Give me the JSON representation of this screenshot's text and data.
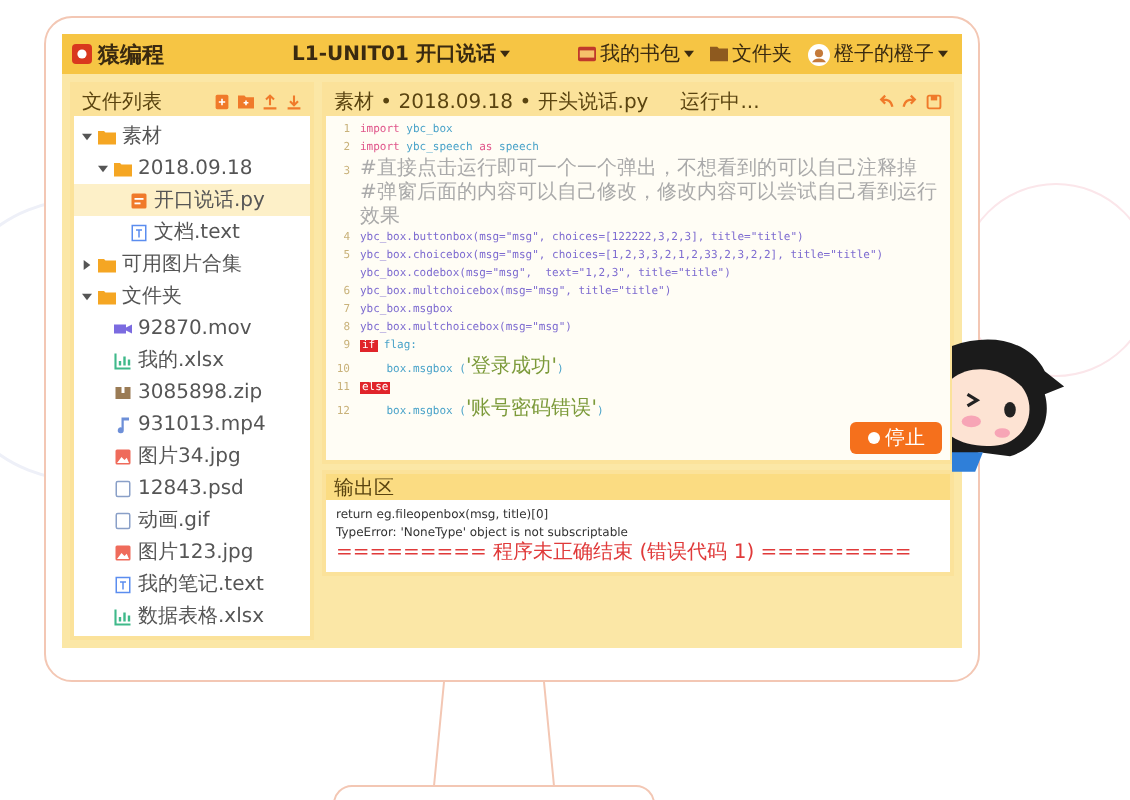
{
  "app": {
    "logo": "猿编程",
    "lesson": {
      "label": "L1-UNIT01 开口说话",
      "dropdown": true
    },
    "menu": [
      {
        "label": "我的书包",
        "kind": "bag",
        "dropdown": true
      },
      {
        "label": "文件夹",
        "kind": "folder",
        "dropdown": false
      }
    ],
    "user": {
      "name": "橙子的橙子",
      "dropdown": true
    }
  },
  "file_panel": {
    "title": "文件列表",
    "tree": [
      {
        "name": "素材",
        "kind": "folder",
        "expanded": true,
        "selected": false,
        "children": [
          {
            "name": "2018.09.18",
            "kind": "folder",
            "expanded": true,
            "selected": false,
            "children": [
              {
                "name": "开口说话.py",
                "kind": "py",
                "selected": true
              },
              {
                "name": "文档.text",
                "kind": "text",
                "selected": false
              }
            ]
          }
        ]
      },
      {
        "name": "可用图片合集",
        "kind": "folder",
        "expanded": false,
        "selected": false
      },
      {
        "name": "文件夹",
        "kind": "folder",
        "expanded": true,
        "selected": false,
        "children": [
          {
            "name": "92870.mov",
            "kind": "video",
            "selected": false
          },
          {
            "name": "我的.xlsx",
            "kind": "sheet",
            "selected": false
          },
          {
            "name": "3085898.zip",
            "kind": "zip",
            "selected": false
          },
          {
            "name": "931013.mp4",
            "kind": "audio",
            "selected": false
          },
          {
            "name": "图片34.jpg",
            "kind": "image",
            "selected": false
          },
          {
            "name": "12843.psd",
            "kind": "doc",
            "selected": false
          },
          {
            "name": "动画.gif",
            "kind": "doc",
            "selected": false
          },
          {
            "name": "图片123.jpg",
            "kind": "image",
            "selected": false
          },
          {
            "name": "我的笔记.text",
            "kind": "text",
            "selected": false
          },
          {
            "name": "数据表格.xlsx",
            "kind": "sheet",
            "selected": false
          }
        ]
      }
    ]
  },
  "editor": {
    "breadcrumb": "素材 • 2018.09.18 • 开头说话.py",
    "status": "运行中...",
    "lines": [
      {
        "number": "1",
        "tokens": [
          {
            "kind": "keyword",
            "text": "import"
          },
          {
            "kind": "name",
            "text": " ybc_box"
          }
        ]
      },
      {
        "number": "2",
        "tokens": [
          {
            "kind": "keyword",
            "text": "import"
          },
          {
            "kind": "name",
            "text": " ybc_speech "
          },
          {
            "kind": "keyword",
            "text": "as"
          },
          {
            "kind": "name",
            "text": " speech"
          }
        ]
      },
      {
        "number": "3",
        "tokens": [
          {
            "kind": "comment",
            "text": "#直接点击运行即可一个一个弹出，不想看到的可以自己注释掉"
          }
        ]
      },
      {
        "tokens": [
          {
            "kind": "comment",
            "text": "#弹窗后面的内容可以自己修改，修改内容可以尝试自己看到运行效果"
          }
        ]
      },
      {
        "number": "4",
        "tokens": [
          {
            "kind": "call",
            "text": "ybc_box.buttonbox(msg=\"msg\", choices=[122222,3,2,3], title=\"title\")"
          }
        ]
      },
      {
        "number": "5",
        "tokens": [
          {
            "kind": "call",
            "text": "ybc_box.choicebox(msg=\"msg\", choices=[1,2,3,3,2,1,2,33,2,3,2,2], title=\"title\")"
          }
        ]
      },
      {
        "tokens": [
          {
            "kind": "call",
            "text": "ybc_box.codebox(msg=\"msg\",  text=\"1,2,3\", title=\"title\")"
          }
        ]
      },
      {
        "number": "6",
        "tokens": [
          {
            "kind": "call",
            "text": "ybc_box.multchoicebox(msg=\"msg\", title=\"title\")"
          }
        ]
      },
      {
        "number": "7",
        "tokens": [
          {
            "kind": "call",
            "text": "ybc_box.msgbox"
          }
        ]
      },
      {
        "number": "8",
        "tokens": [
          {
            "kind": "call",
            "text": "ybc_box.multchoicebox(msg=\"msg\")"
          }
        ]
      },
      {
        "number": "9",
        "tokens": [
          {
            "kind": "flagged",
            "text": "if"
          },
          {
            "kind": "name",
            "text": " flag:"
          }
        ]
      },
      {
        "number": "10",
        "tokens": [
          {
            "kind": "name",
            "text": "    box.msgbox ("
          },
          {
            "kind": "string",
            "text": "'登录成功'"
          },
          {
            "kind": "name",
            "text": ")"
          }
        ]
      },
      {
        "number": "11",
        "tokens": [
          {
            "kind": "flagged",
            "text": "else"
          }
        ]
      },
      {
        "number": "12",
        "tokens": [
          {
            "kind": "name",
            "text": "    box.msgbox ("
          },
          {
            "kind": "string",
            "text": "'账号密码错误'"
          },
          {
            "kind": "name",
            "text": ")"
          }
        ]
      }
    ],
    "stop_button": "停止"
  },
  "output": {
    "title": "输出区",
    "lines": [
      {
        "kind": "plain",
        "text": "return eg.fileopenbox(msg, title)[0]"
      },
      {
        "kind": "plain",
        "text": "TypeError: 'NoneType' object is not subscriptable"
      },
      {
        "kind": "error",
        "text": "========= 程序未正确结束 (错误代码 1) ========="
      }
    ]
  }
}
